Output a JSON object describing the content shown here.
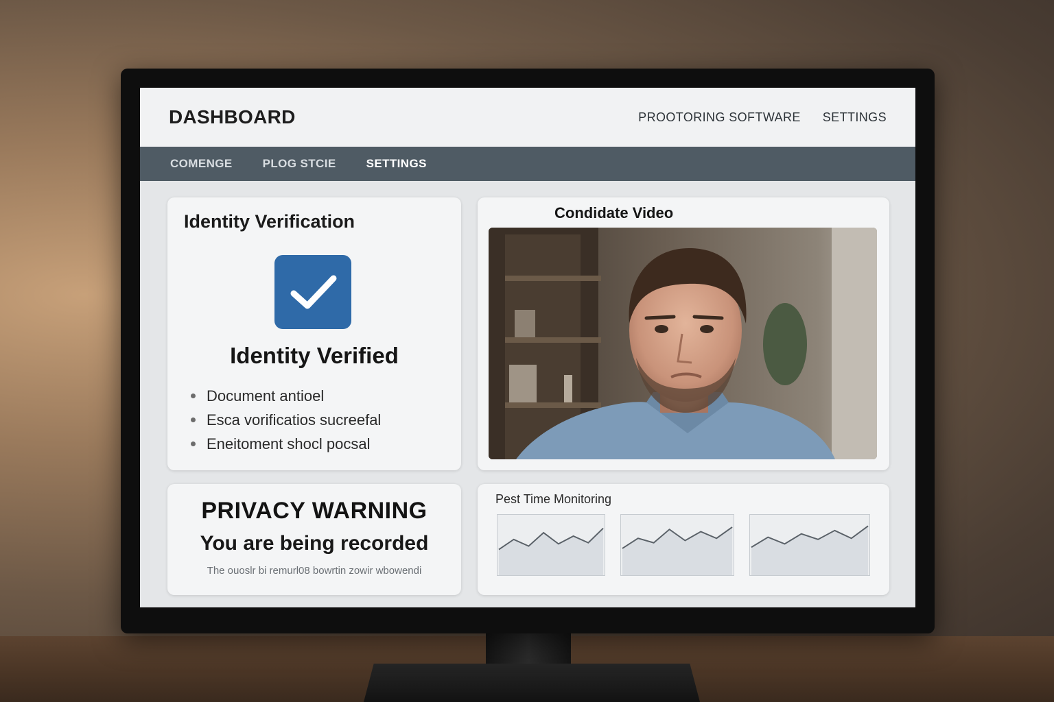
{
  "app": {
    "title": "DASHBOARD",
    "top_links": [
      "PROOTORING SOFTWARE",
      "SETTINGS"
    ]
  },
  "nav": {
    "tabs": [
      "COMENGE",
      "PLOG STCIE",
      "SETTINGS"
    ],
    "active_tab": "SETTINGS"
  },
  "identity": {
    "title": "Identity Verification",
    "badge_icon": "checkmark-icon",
    "status": "Identity Verified",
    "checks": [
      "Document antioel",
      "Esca vorificatios sucreefal",
      "Eneitoment shocl pocsal"
    ]
  },
  "video": {
    "label": "Condidate Video"
  },
  "privacy": {
    "title": "PRIVACY WARNING",
    "subtitle": "You are being recorded",
    "note": "The ouoslr bi remurl08 bowrtin zowir wbowendi"
  },
  "monitoring": {
    "label": "Pest Time Monitoring",
    "graphs": [
      {
        "values": [
          10,
          28,
          16,
          40,
          20,
          34,
          22,
          48
        ]
      },
      {
        "values": [
          12,
          30,
          22,
          46,
          26,
          42,
          30,
          50
        ]
      },
      {
        "values": [
          14,
          32,
          20,
          38,
          28,
          44,
          30,
          52
        ]
      }
    ]
  },
  "colors": {
    "accent": "#2f6aa8",
    "navbar": "#4f5b64",
    "screen_bg": "#e4e6e8"
  }
}
